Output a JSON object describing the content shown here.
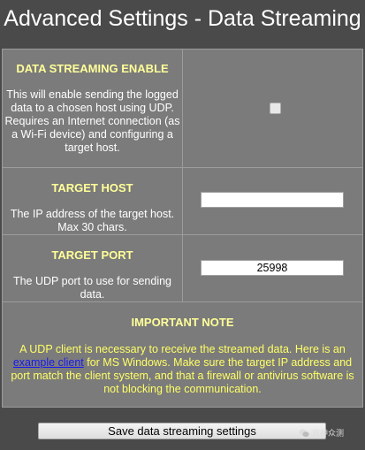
{
  "page": {
    "title": "Advanced Settings - Data Streaming"
  },
  "streaming_enable": {
    "heading": "DATA STREAMING ENABLE",
    "description": "This will enable sending the logged data to a chosen host using UDP. Requires an Internet connection (as a Wi-Fi device) and configuring a target host.",
    "checked": false
  },
  "target_host": {
    "heading": "TARGET HOST",
    "description": "The IP address of the target host. Max 30 chars.",
    "value": ""
  },
  "target_port": {
    "heading": "TARGET PORT",
    "description": "The UDP port to use for sending data.",
    "value": "25998"
  },
  "important_note": {
    "heading": "IMPORTANT NOTE",
    "text_before_link": "A UDP client is necessary to receive the streamed data. Here is an ",
    "link_text": "example client",
    "text_after_link": " for MS Windows. Make sure the target IP address and port match the client system, and that a firewall or antivirus software is not blocking the communication."
  },
  "save_button": {
    "label": "Save data streaming settings"
  },
  "watermark": {
    "text": "宫神众测",
    "icon": "wechat-icon"
  },
  "colors": {
    "background": "#4a4a4a",
    "panel": "#7b7b7b",
    "heading": "#ffff99",
    "note_text": "#ffff66",
    "link": "#1a1aee"
  }
}
